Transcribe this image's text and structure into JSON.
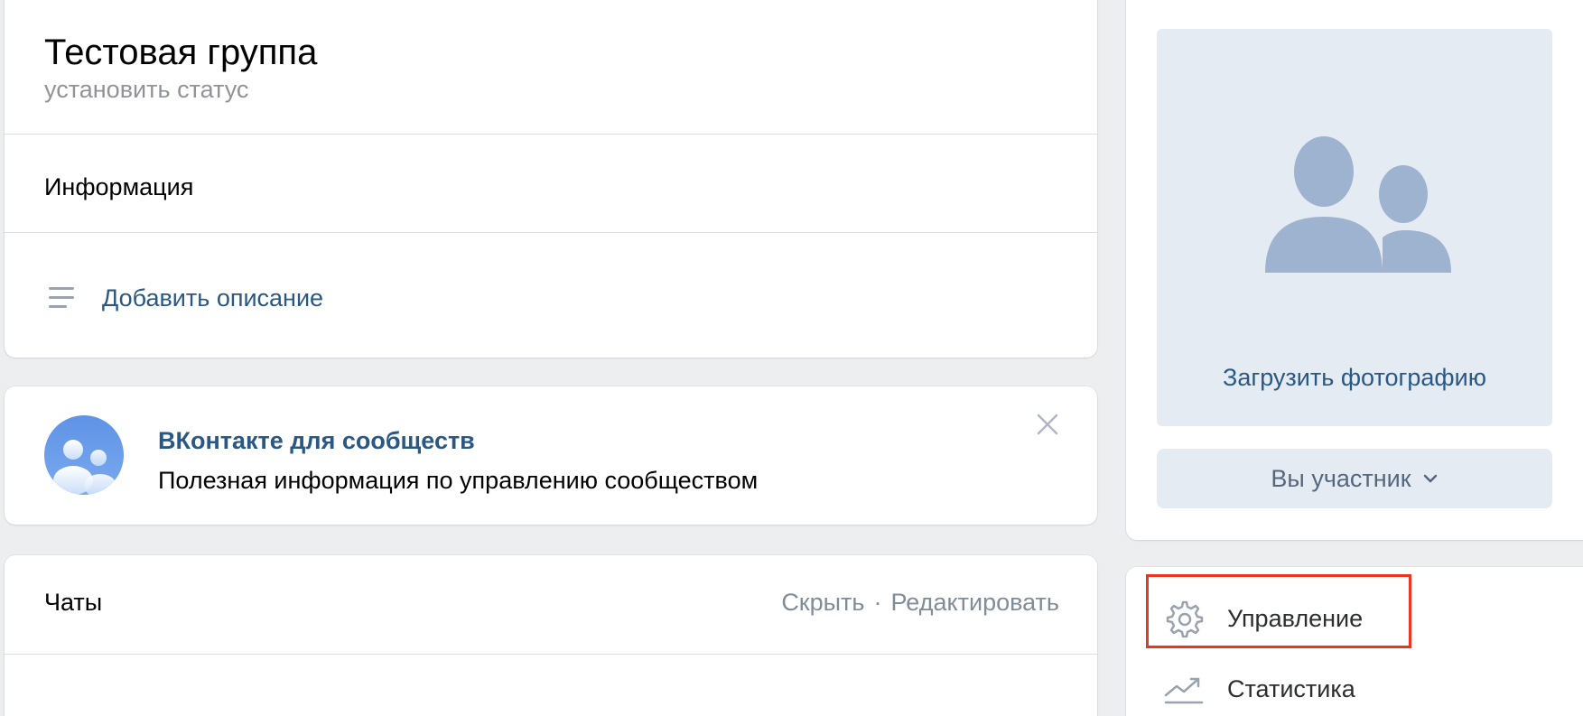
{
  "header": {
    "group_title": "Тестовая группа",
    "status_placeholder": "установить статус",
    "info_label": "Информация",
    "add_description": "Добавить описание"
  },
  "promo": {
    "title": "ВКонтакте для сообществ",
    "text": "Полезная информация по управлению сообществом"
  },
  "chats": {
    "label": "Чаты",
    "hide": "Скрыть",
    "separator": "·",
    "edit": "Редактировать"
  },
  "photo": {
    "upload_label": "Загрузить фотографию",
    "member_button": "Вы участник"
  },
  "menu": {
    "items": [
      {
        "label": "Управление",
        "icon": "gear-icon",
        "highlighted": true
      },
      {
        "label": "Статистика",
        "icon": "trend-icon",
        "highlighted": false
      }
    ]
  },
  "colors": {
    "link": "#2a5885",
    "background": "#edeef0",
    "placeholder_bg": "#e5ebf2",
    "highlight": "#e8371c"
  }
}
